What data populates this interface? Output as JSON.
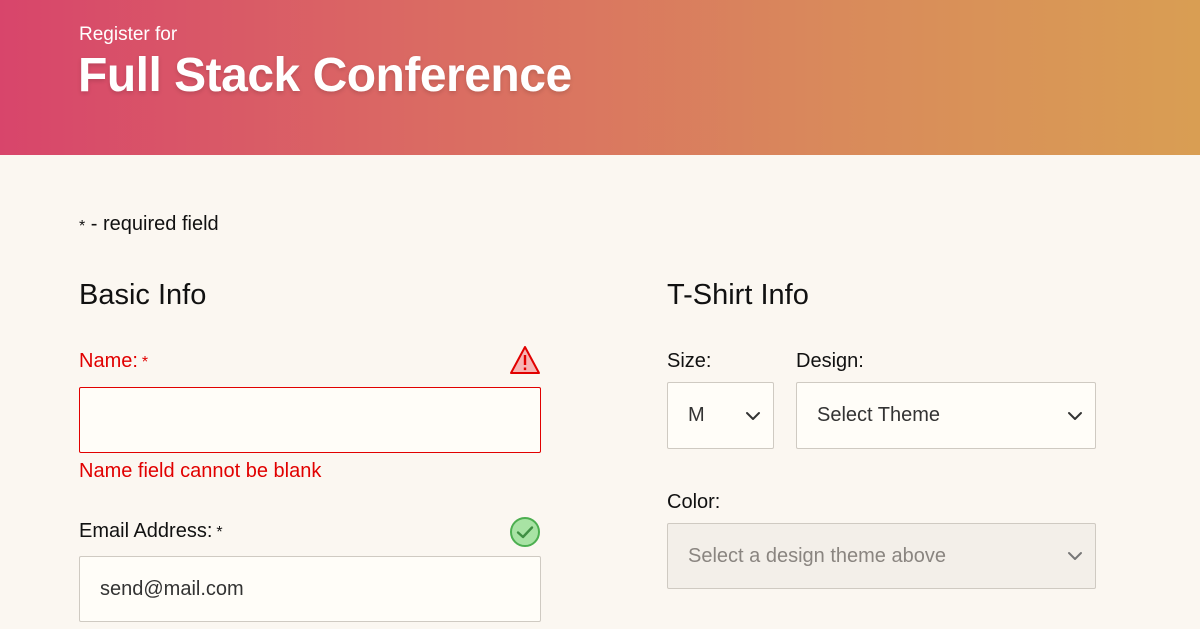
{
  "header": {
    "kicker": "Register for",
    "title": "Full Stack Conference",
    "gradient_colors": [
      "#d8456b",
      "#d99e53"
    ]
  },
  "required_note": {
    "star": "*",
    "text": " - required field"
  },
  "basic_info": {
    "title": "Basic Info",
    "name": {
      "label": "Name:",
      "required_marker": "*",
      "value": "",
      "status_icon": "warning-triangle-icon",
      "error_message": "Name field cannot be blank"
    },
    "email": {
      "label": "Email Address:",
      "required_marker": "*",
      "value": "send@mail.com",
      "status_icon": "checkmark-circle-icon"
    }
  },
  "tshirt_info": {
    "title": "T-Shirt Info",
    "size": {
      "label": "Size:",
      "selected": "M"
    },
    "design": {
      "label": "Design:",
      "selected": "Select Theme"
    },
    "color": {
      "label": "Color:",
      "selected": "Select a design theme above",
      "disabled": true
    }
  },
  "colors": {
    "error": "#e10000",
    "success": "#4caf50",
    "background": "#fbf7f1"
  }
}
